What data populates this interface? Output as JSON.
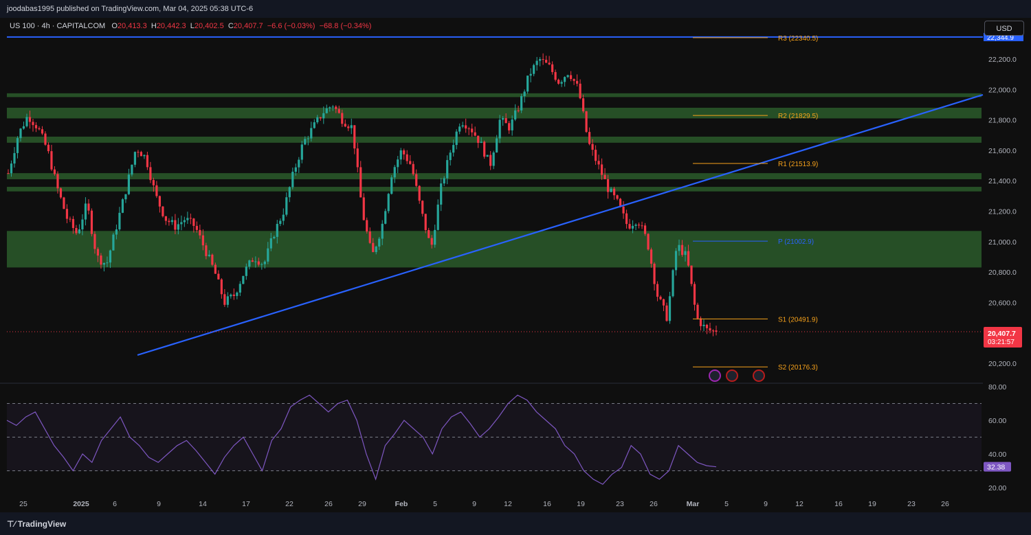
{
  "header": {
    "published": "joodabas1995 published on TradingView.com, Mar 04, 2025 05:38 UTC-6",
    "symbol": "US 100 · 4h · CAPITALCOM",
    "o_label": "O",
    "o": "20,413.3",
    "h_label": "H",
    "h": "20,442.3",
    "l_label": "L",
    "l": "20,402.5",
    "c_label": "C",
    "c": "20,407.7",
    "change": "−6.6 (−0.03%)",
    "change2": "−68.8 (−0.34%)"
  },
  "currency_button": "USD",
  "footer": {
    "brand": "TradingView"
  },
  "colors": {
    "bull": "#26a69a",
    "bear": "#f23645",
    "zone": "#2a5a2a",
    "trend": "#2962ff",
    "pivot": "#2962ff",
    "level": "#f7a21b",
    "rsi": "#7e57c2",
    "price_tag": "#f23645",
    "rsi_tag": "#7e57c2"
  },
  "price_axis": {
    "ticks": [
      "22,200.0",
      "22,000.0",
      "21,800.0",
      "21,600.0",
      "21,400.0",
      "21,200.0",
      "21,000.0",
      "20,800.0",
      "20,600.0",
      "20,400.0",
      "20,200.0"
    ],
    "last_price": "20,407.7",
    "countdown": "03:21:57",
    "top_hidden": "22,344.9"
  },
  "rsi_axis": {
    "ticks": [
      "80.00",
      "60.00",
      "40.00",
      "20.00"
    ],
    "last": "32.38"
  },
  "time_axis": [
    "25",
    "2025",
    "6",
    "9",
    "14",
    "17",
    "22",
    "26",
    "29",
    "Feb",
    "5",
    "9",
    "12",
    "16",
    "19",
    "23",
    "26",
    "Mar",
    "5",
    "9",
    "12",
    "16",
    "19",
    "23",
    "26"
  ],
  "chart_data": [
    {
      "type": "candlestick",
      "title": "US 100 · 4h · CAPITALCOM",
      "ylim": [
        20100,
        22400
      ],
      "pivots": [
        {
          "label": "R3 (22340.5)",
          "value": 22340.5
        },
        {
          "label": "R2 (21829.5)",
          "value": 21829.5
        },
        {
          "label": "R1 (21513.9)",
          "value": 21513.9
        },
        {
          "label": "P (21002.9)",
          "value": 21002.9
        },
        {
          "label": "S1 (20491.9)",
          "value": 20491.9
        },
        {
          "label": "S2 (20176.3)",
          "value": 20176.3
        }
      ],
      "horizontal_line": 22344.9,
      "zones": [
        [
          21950,
          21975
        ],
        [
          21810,
          21880
        ],
        [
          21650,
          21690
        ],
        [
          21410,
          21450
        ],
        [
          21330,
          21360
        ],
        [
          20830,
          21070
        ]
      ],
      "trendline": {
        "from": [
          "Jan 7",
          20260
        ],
        "to": [
          "Mar 26+",
          21960
        ]
      },
      "path": [
        21450,
        21700,
        21830,
        21750,
        21600,
        21350,
        21150,
        21050,
        21250,
        20900,
        20850,
        21100,
        21350,
        21620,
        21550,
        21300,
        21150,
        21100,
        21150,
        21100,
        20950,
        20800,
        20600,
        20650,
        20800,
        20900,
        20850,
        21050,
        21200,
        21450,
        21650,
        21750,
        21850,
        21900,
        21800,
        21750,
        21200,
        20900,
        21100,
        21450,
        21600,
        21500,
        21200,
        20950,
        21350,
        21600,
        21800,
        21750,
        21650,
        21500,
        21800,
        21750,
        21900,
        22100,
        22200,
        22150,
        22050,
        22120,
        22000,
        21650,
        21500,
        21350,
        21250,
        21100,
        21150,
        21000,
        20650,
        20500,
        20980,
        20900,
        20500,
        20420,
        20408
      ]
    },
    {
      "type": "line",
      "title": "RSI",
      "ylim": [
        15,
        85
      ],
      "levels": [
        70,
        50,
        30
      ],
      "values": [
        60,
        57,
        62,
        65,
        55,
        45,
        38,
        30,
        40,
        35,
        48,
        55,
        62,
        50,
        45,
        38,
        35,
        40,
        45,
        48,
        42,
        35,
        28,
        38,
        45,
        50,
        40,
        30,
        48,
        55,
        68,
        72,
        75,
        70,
        65,
        70,
        72,
        60,
        40,
        25,
        45,
        52,
        60,
        55,
        50,
        40,
        55,
        62,
        65,
        58,
        50,
        55,
        62,
        70,
        75,
        72,
        65,
        60,
        55,
        45,
        40,
        30,
        25,
        22,
        28,
        32,
        45,
        40,
        28,
        25,
        30,
        45,
        40,
        35,
        33,
        32.38
      ]
    }
  ]
}
